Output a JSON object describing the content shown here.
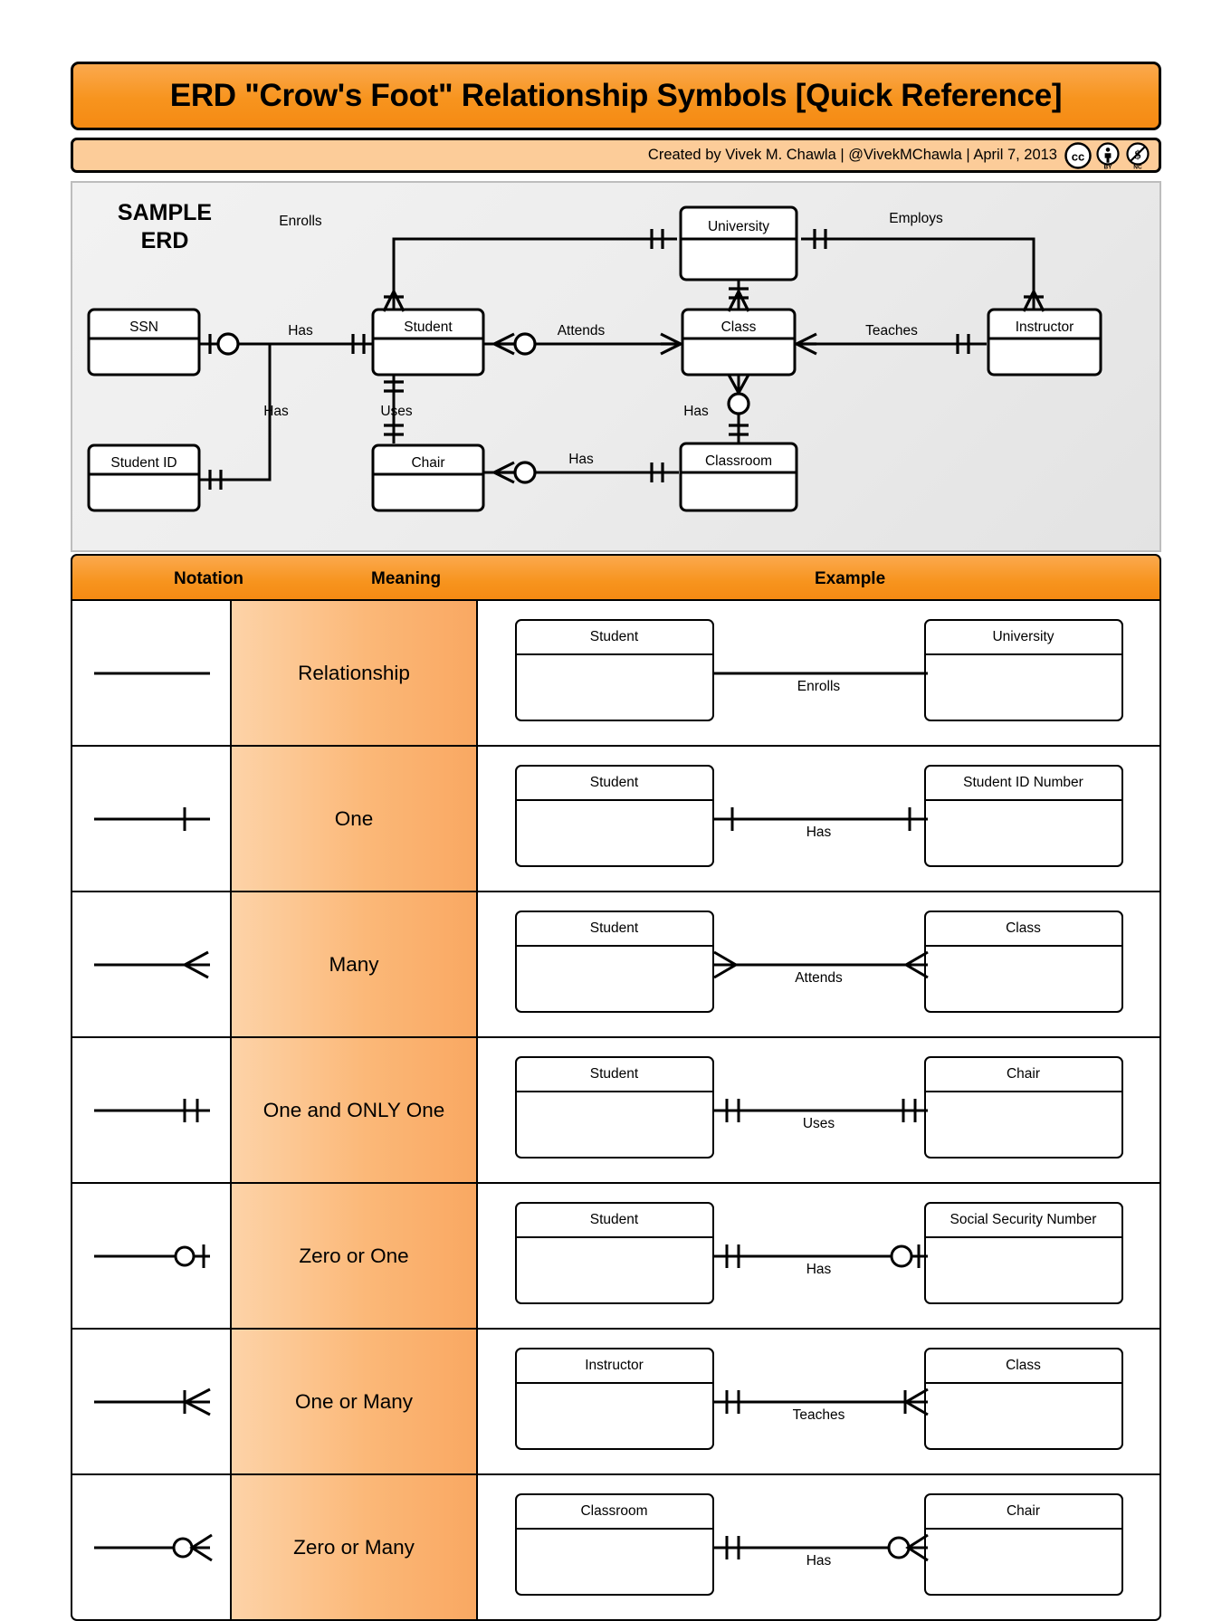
{
  "header": {
    "title": "ERD \"Crow's Foot\" Relationship Symbols [Quick Reference]",
    "credit": "Created by Vivek M. Chawla |  @VivekMChawla  |  April 7, 2013",
    "license": {
      "cc": "cc",
      "by": "BY",
      "nc": "NC"
    }
  },
  "sample_erd": {
    "label": "SAMPLE\nERD",
    "entities": [
      {
        "id": "ssn",
        "name": "SSN"
      },
      {
        "id": "student_id",
        "name": "Student ID"
      },
      {
        "id": "student",
        "name": "Student"
      },
      {
        "id": "chair",
        "name": "Chair"
      },
      {
        "id": "university",
        "name": "University"
      },
      {
        "id": "class",
        "name": "Class"
      },
      {
        "id": "classroom",
        "name": "Classroom"
      },
      {
        "id": "instructor",
        "name": "Instructor"
      }
    ],
    "relationships": [
      {
        "label": "Has",
        "from": "ssn",
        "to": "student"
      },
      {
        "label": "Has",
        "from": "student_id",
        "to": "student"
      },
      {
        "label": "Uses",
        "from": "student",
        "to": "chair"
      },
      {
        "label": "Enrolls",
        "from": "student",
        "to": "university"
      },
      {
        "label": "Attends",
        "from": "student",
        "to": "class"
      },
      {
        "label": "Employs",
        "from": "university",
        "to": "instructor"
      },
      {
        "label": "Teaches",
        "from": "class",
        "to": "instructor"
      },
      {
        "label": "Has",
        "from": "class",
        "to": "classroom"
      }
    ]
  },
  "table": {
    "columns": [
      "Notation",
      "Meaning",
      "Example"
    ],
    "rows": [
      {
        "notation": "plain-line",
        "meaning": "Relationship",
        "example": {
          "left": "Student",
          "right": "University",
          "label": "Enrolls",
          "left_symbol": "none",
          "right_symbol": "none"
        }
      },
      {
        "notation": "one",
        "meaning": "One",
        "example": {
          "left": "Student",
          "right": "Student ID Number",
          "label": "Has",
          "left_symbol": "one",
          "right_symbol": "one"
        }
      },
      {
        "notation": "many",
        "meaning": "Many",
        "example": {
          "left": "Student",
          "right": "Class",
          "label": "Attends",
          "left_symbol": "many",
          "right_symbol": "many"
        }
      },
      {
        "notation": "one-only-one",
        "meaning": "One and ONLY One",
        "example": {
          "left": "Student",
          "right": "Chair",
          "label": "Uses",
          "left_symbol": "one-only-one",
          "right_symbol": "one-only-one"
        }
      },
      {
        "notation": "zero-or-one",
        "meaning": "Zero or One",
        "example": {
          "left": "Student",
          "right": "Social Security Number",
          "label": "Has",
          "left_symbol": "one-only-one",
          "right_symbol": "zero-or-one"
        }
      },
      {
        "notation": "one-or-many",
        "meaning": "One or Many",
        "example": {
          "left": "Instructor",
          "right": "Class",
          "label": "Teaches",
          "left_symbol": "one-only-one",
          "right_symbol": "one-or-many"
        }
      },
      {
        "notation": "zero-or-many",
        "meaning": "Zero or Many",
        "example": {
          "left": "Classroom",
          "right": "Chair",
          "label": "Has",
          "left_symbol": "one-only-one",
          "right_symbol": "zero-or-many"
        }
      }
    ]
  },
  "colors": {
    "header_orange": "#F7941E",
    "credit_orange": "#FCCC99",
    "meaning_orange_light": "#FDD3A8",
    "meaning_orange_dark": "#F9A862",
    "panel_gray": "#EDEDED",
    "line": "#000000"
  }
}
